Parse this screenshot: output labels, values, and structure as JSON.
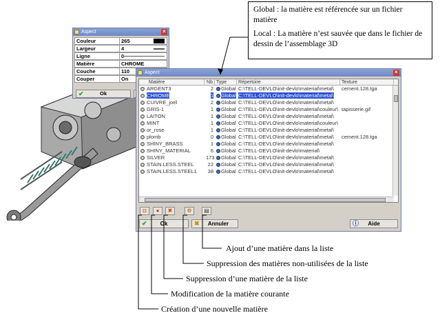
{
  "callout": {
    "global_text": "Global : la matière est référencée sur un fichier matière",
    "local_text": "Local : La matière n’est sauvée que dans le fichier de dessin de l’assemblage 3D"
  },
  "small_dialog": {
    "title": "Aspect",
    "rows": [
      {
        "label": "Couleur",
        "value": "265"
      },
      {
        "label": "Largeur",
        "value": "4"
      },
      {
        "label": "Ligne",
        "value": "0"
      },
      {
        "label": "Matière",
        "value": "CHROME"
      },
      {
        "label": "Couche",
        "value": "110"
      },
      {
        "label": "Couper",
        "value": "On"
      }
    ],
    "ok_label": "Ok"
  },
  "large_dialog": {
    "title": "Aspect",
    "columns": [
      "Matière",
      "Nb",
      "Type",
      "Répertoire",
      "Texture"
    ],
    "rows": [
      {
        "name": "ARGENT3",
        "nb": "2",
        "type": "Global",
        "dir": "C:\\TELL-DEVLO\\init-devlo\\material\\metal\\",
        "tex": "cement.128.tga"
      },
      {
        "name": "CHROME",
        "nb": "1",
        "type": "Global",
        "dir": "C:\\TELL-DEVLO\\init-devlo\\material\\metal\\",
        "tex": ""
      },
      {
        "name": "CUIVRE_joel",
        "nb": "2",
        "type": "Global",
        "dir": "C:\\TELL-DEVLO\\init-devlo\\material\\metal\\",
        "tex": ""
      },
      {
        "name": "GRIS-1",
        "nb": "1",
        "type": "Global",
        "dir": "C:\\TELL-DEVLO\\init-devlo\\material\\couleur\\",
        "tex": "tapisserie.gif"
      },
      {
        "name": "LAITON",
        "nb": "1",
        "type": "Global",
        "dir": "C:\\TELL-DEVLO\\init-devlo\\material\\metal\\",
        "tex": ""
      },
      {
        "name": "MINT",
        "nb": "1",
        "type": "Global",
        "dir": "C:\\TELL-DEVLO\\init-devlo\\material\\couleur\\",
        "tex": ""
      },
      {
        "name": "or_rose",
        "nb": "1",
        "type": "Global",
        "dir": "C:\\TELL-DEVLO\\init-devlo\\material\\metal\\",
        "tex": ""
      },
      {
        "name": "plomb",
        "nb": "0",
        "type": "Global",
        "dir": "C:\\TELL-DEVLO\\init-devlo\\material\\metal\\",
        "tex": "cement.128.tga"
      },
      {
        "name": "SHINY_BRASS",
        "nb": "1",
        "type": "Global",
        "dir": "C:\\TELL-DEVLO\\init-devlo\\material\\metal\\",
        "tex": ""
      },
      {
        "name": "SHINY_MATERIAL",
        "nb": "6",
        "type": "Global",
        "dir": "C:\\TELL-DEVLO\\init-devlo\\material\\",
        "tex": ""
      },
      {
        "name": "SILVER",
        "nb": "173",
        "type": "Global",
        "dir": "C:\\TELL-DEVLO\\init-devlo\\material\\metal\\",
        "tex": ""
      },
      {
        "name": "STAIN.LESS.STEEL",
        "nb": "22",
        "type": "Global",
        "dir": "C:\\TELL-DEVLO\\init-devlo\\material\\metal\\",
        "tex": ""
      },
      {
        "name": "STAIN.LESS.STEEL1",
        "nb": "38",
        "type": "Global",
        "dir": "C:\\TELL-DEVLO\\init-devlo\\material\\metal\\",
        "tex": ""
      }
    ],
    "ok_label": "Ok",
    "cancel_label": "Annuler",
    "help_label": "Aide"
  },
  "annotations": {
    "ajout": "Ajout d’une matière dans la liste",
    "suppression_non_utilisees": "Suppression des matières non-utilisées de la liste",
    "suppression": "Suppression d’une matière de la liste",
    "modification": "Modification de la matière courante",
    "creation": "Création d’une nouvelle matière"
  }
}
